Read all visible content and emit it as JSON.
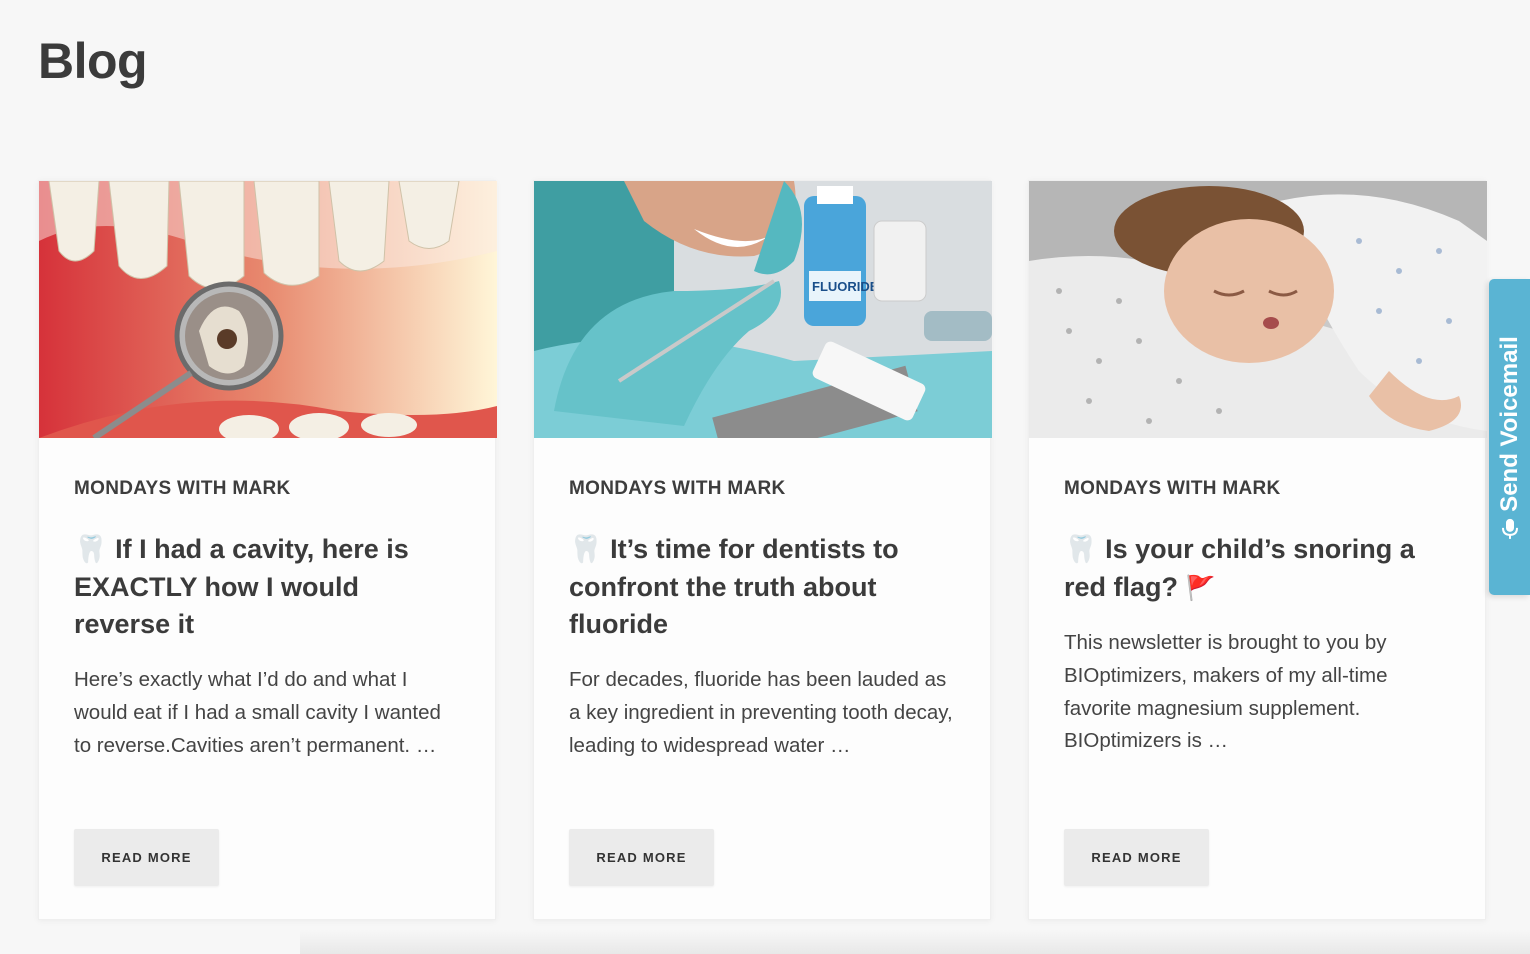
{
  "page": {
    "title": "Blog"
  },
  "posts": [
    {
      "category": "MONDAYS WITH MARK",
      "title_icon": "🦷",
      "title": "If I had a cavity, here is EXACTLY how I would reverse it",
      "excerpt": "Here’s exactly what I’d do and what I would eat if I had a small cavity I wanted to reverse.Cavities aren’t permanent. …",
      "read_more": "READ MORE",
      "image": "teeth-cavity-dental-mirror"
    },
    {
      "category": "MONDAYS WITH MARK",
      "title_icon": "🦷",
      "title": "It’s time for dentists to confront the truth about fluoride",
      "excerpt": "For decades, fluoride has been lauded as a key ingredient in preventing tooth decay, leading to widespread water …",
      "read_more": "READ MORE",
      "image": "dentist-fluoride-treatment",
      "image_text": "FLUORIDE"
    },
    {
      "category": "MONDAYS WITH MARK",
      "title_icon": "🦷",
      "title": "Is your child’s snoring a red flag?",
      "title_suffix_icon": "🚩",
      "excerpt": "This newsletter is brought to you by BIOptimizers, makers of my all-time favorite magnesium supplement. BIOptimizers is …",
      "read_more": "READ MORE",
      "image": "sleeping-child"
    }
  ],
  "voicemail": {
    "label": "Send Voicemail",
    "icon": "microphone-icon",
    "color": "#5ab4d3"
  }
}
